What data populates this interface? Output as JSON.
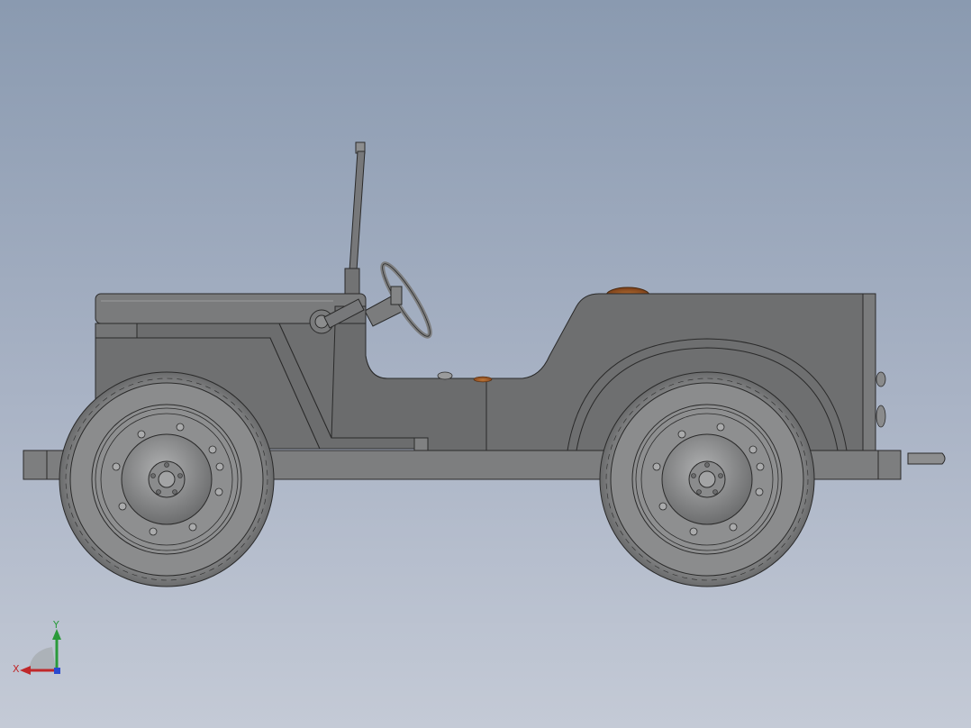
{
  "viewport": {
    "background_top": "#8a9ab0",
    "background_bottom": "#c4cad6",
    "model": "jeep-side-view"
  },
  "colors": {
    "body": "#6e6f70",
    "body_light": "#7c7d7e",
    "edge": "#2a2a2a",
    "tire": "#8b8c8d",
    "hub": "#9a9b9c",
    "lamp": "#9c5a2a",
    "axis_x": "#c0282a",
    "axis_y": "#2a9a3a",
    "axis_z": "#2a4ad0"
  },
  "triad": {
    "x_label": "X",
    "y_label": "Y"
  }
}
